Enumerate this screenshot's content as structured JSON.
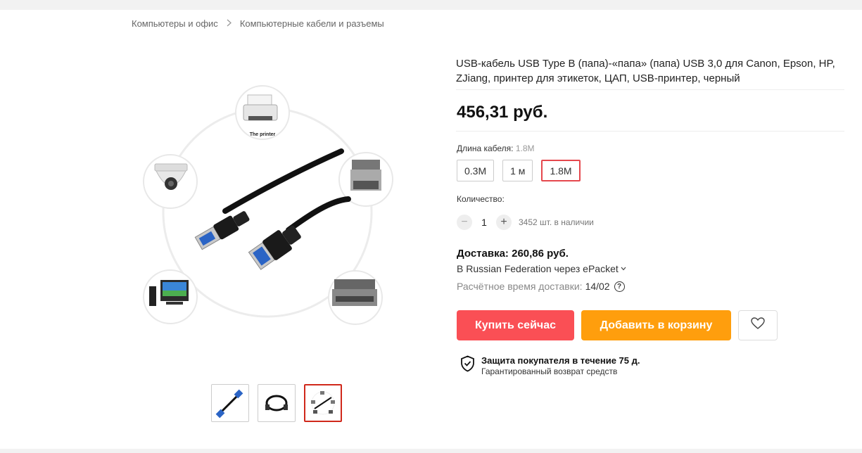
{
  "breadcrumb": {
    "items": [
      "Компьютеры и офис",
      "Компьютерные кабели и разъемы"
    ]
  },
  "gallery": {
    "main_labels": {
      "printer": "The printer"
    },
    "thumbnail_count": 3,
    "active_thumbnail": 3
  },
  "product": {
    "title": "USB-кабель USB Type B (папа)-«папа» (папа) USB 3,0 для Canon, Epson, HP, ZJiang, принтер для этикеток, ЦАП, USB-принтер, черный",
    "price": "456,31 руб."
  },
  "length": {
    "label": "Длина кабеля:",
    "selected": "1.8M",
    "options": [
      "0.3M",
      "1 м",
      "1.8M"
    ]
  },
  "quantity": {
    "label": "Количество:",
    "minus": "−",
    "value": "1",
    "plus": "+",
    "stock": "3452 шт. в наличии"
  },
  "shipping": {
    "price": "Доставка: 260,86 руб.",
    "method": "В Russian Federation через ePacket",
    "time_label": "Расчётное время доставки:",
    "time_value": "14/02",
    "help": "?"
  },
  "actions": {
    "buy_now": "Купить сейчас",
    "add_to_cart": "Добавить в корзину"
  },
  "protection": {
    "title": "Защита покупателя в течение 75 д.",
    "subtitle": "Гарантированный возврат средств"
  },
  "colors": {
    "buy": "#fa4f55",
    "cart": "#ff9e0d",
    "active_border": "#e5484d"
  }
}
